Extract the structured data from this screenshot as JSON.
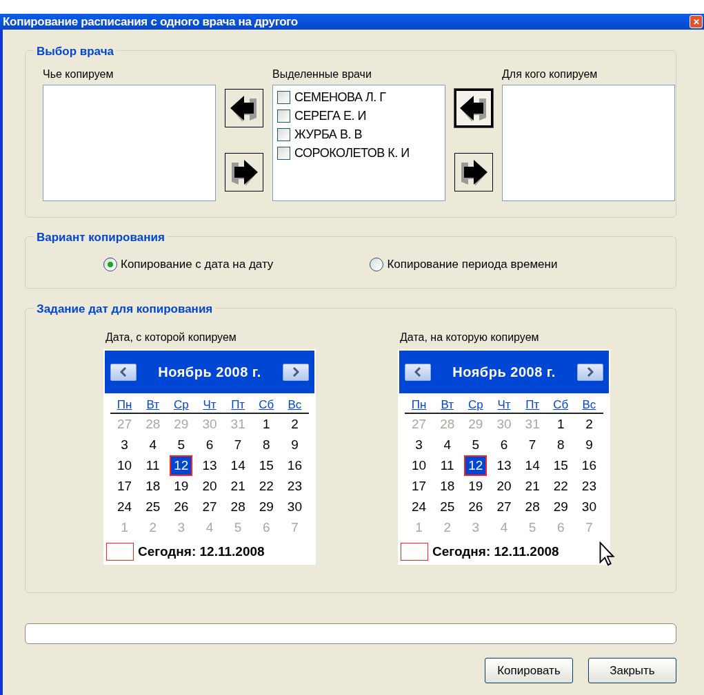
{
  "window": {
    "title": "Копирование расписания с одного врача на другого",
    "close": "✕"
  },
  "doctor_group": {
    "title": "Выбор врача",
    "source": {
      "label": "Чье копируем"
    },
    "selected": {
      "label": "Выделенные врачи",
      "items": [
        {
          "label": "СЕМЕНОВА Л. Г",
          "checked": false
        },
        {
          "label": "СЕРЕГА Е. И",
          "checked": false
        },
        {
          "label": "ЖУРБА В. В",
          "checked": false
        },
        {
          "label": "СОРОКОЛЕТОВ К. И",
          "checked": false
        }
      ]
    },
    "target": {
      "label": "Для кого копируем"
    },
    "left_arrows": [
      {
        "kind": "left",
        "focused": false
      },
      {
        "kind": "right",
        "focused": false
      }
    ],
    "right_arrows": [
      {
        "kind": "left",
        "focused": true
      },
      {
        "kind": "right",
        "focused": false
      }
    ]
  },
  "variant_group": {
    "title": "Вариант копирования",
    "options": [
      {
        "label": "Копирование с дата на дату",
        "selected": true
      },
      {
        "label": "Копирование периода времени",
        "selected": false
      }
    ]
  },
  "dates_group": {
    "title": "Задание дат для копирования",
    "calendars": [
      {
        "label": "Дата, с которой копируем",
        "month": "Ноябрь 2008 г.",
        "weekdays": [
          "Пн",
          "Вт",
          "Ср",
          "Чт",
          "Пт",
          "Сб",
          "Вс"
        ],
        "today": "Сегодня: 12.11.2008",
        "weeks": [
          [
            {
              "d": "27",
              "muted": true,
              "selected": false
            },
            {
              "d": "28",
              "muted": true,
              "selected": false
            },
            {
              "d": "29",
              "muted": true,
              "selected": false
            },
            {
              "d": "30",
              "muted": true,
              "selected": false
            },
            {
              "d": "31",
              "muted": true,
              "selected": false
            },
            {
              "d": "1",
              "muted": false,
              "selected": false
            },
            {
              "d": "2",
              "muted": false,
              "selected": false
            }
          ],
          [
            {
              "d": "3",
              "muted": false,
              "selected": false
            },
            {
              "d": "4",
              "muted": false,
              "selected": false
            },
            {
              "d": "5",
              "muted": false,
              "selected": false
            },
            {
              "d": "6",
              "muted": false,
              "selected": false
            },
            {
              "d": "7",
              "muted": false,
              "selected": false
            },
            {
              "d": "8",
              "muted": false,
              "selected": false
            },
            {
              "d": "9",
              "muted": false,
              "selected": false
            }
          ],
          [
            {
              "d": "10",
              "muted": false,
              "selected": false
            },
            {
              "d": "11",
              "muted": false,
              "selected": false
            },
            {
              "d": "12",
              "muted": false,
              "selected": true
            },
            {
              "d": "13",
              "muted": false,
              "selected": false
            },
            {
              "d": "14",
              "muted": false,
              "selected": false
            },
            {
              "d": "15",
              "muted": false,
              "selected": false
            },
            {
              "d": "16",
              "muted": false,
              "selected": false
            }
          ],
          [
            {
              "d": "17",
              "muted": false,
              "selected": false
            },
            {
              "d": "18",
              "muted": false,
              "selected": false
            },
            {
              "d": "19",
              "muted": false,
              "selected": false
            },
            {
              "d": "20",
              "muted": false,
              "selected": false
            },
            {
              "d": "21",
              "muted": false,
              "selected": false
            },
            {
              "d": "22",
              "muted": false,
              "selected": false
            },
            {
              "d": "23",
              "muted": false,
              "selected": false
            }
          ],
          [
            {
              "d": "24",
              "muted": false,
              "selected": false
            },
            {
              "d": "25",
              "muted": false,
              "selected": false
            },
            {
              "d": "26",
              "muted": false,
              "selected": false
            },
            {
              "d": "27",
              "muted": false,
              "selected": false
            },
            {
              "d": "28",
              "muted": false,
              "selected": false
            },
            {
              "d": "29",
              "muted": false,
              "selected": false
            },
            {
              "d": "30",
              "muted": false,
              "selected": false
            }
          ],
          [
            {
              "d": "1",
              "muted": true,
              "selected": false
            },
            {
              "d": "2",
              "muted": true,
              "selected": false
            },
            {
              "d": "3",
              "muted": true,
              "selected": false
            },
            {
              "d": "4",
              "muted": true,
              "selected": false
            },
            {
              "d": "5",
              "muted": true,
              "selected": false
            },
            {
              "d": "6",
              "muted": true,
              "selected": false
            },
            {
              "d": "7",
              "muted": true,
              "selected": false
            }
          ]
        ]
      },
      {
        "label": "Дата, на которую копируем",
        "month": "Ноябрь 2008 г.",
        "weekdays": [
          "Пн",
          "Вт",
          "Ср",
          "Чт",
          "Пт",
          "Сб",
          "Вс"
        ],
        "today": "Сегодня: 12.11.2008",
        "weeks": [
          [
            {
              "d": "27",
              "muted": true,
              "selected": false
            },
            {
              "d": "28",
              "muted": true,
              "selected": false
            },
            {
              "d": "29",
              "muted": true,
              "selected": false
            },
            {
              "d": "30",
              "muted": true,
              "selected": false
            },
            {
              "d": "31",
              "muted": true,
              "selected": false
            },
            {
              "d": "1",
              "muted": false,
              "selected": false
            },
            {
              "d": "2",
              "muted": false,
              "selected": false
            }
          ],
          [
            {
              "d": "3",
              "muted": false,
              "selected": false
            },
            {
              "d": "4",
              "muted": false,
              "selected": false
            },
            {
              "d": "5",
              "muted": false,
              "selected": false
            },
            {
              "d": "6",
              "muted": false,
              "selected": false
            },
            {
              "d": "7",
              "muted": false,
              "selected": false
            },
            {
              "d": "8",
              "muted": false,
              "selected": false
            },
            {
              "d": "9",
              "muted": false,
              "selected": false
            }
          ],
          [
            {
              "d": "10",
              "muted": false,
              "selected": false
            },
            {
              "d": "11",
              "muted": false,
              "selected": false
            },
            {
              "d": "12",
              "muted": false,
              "selected": true
            },
            {
              "d": "13",
              "muted": false,
              "selected": false
            },
            {
              "d": "14",
              "muted": false,
              "selected": false
            },
            {
              "d": "15",
              "muted": false,
              "selected": false
            },
            {
              "d": "16",
              "muted": false,
              "selected": false
            }
          ],
          [
            {
              "d": "17",
              "muted": false,
              "selected": false
            },
            {
              "d": "18",
              "muted": false,
              "selected": false
            },
            {
              "d": "19",
              "muted": false,
              "selected": false
            },
            {
              "d": "20",
              "muted": false,
              "selected": false
            },
            {
              "d": "21",
              "muted": false,
              "selected": false
            },
            {
              "d": "22",
              "muted": false,
              "selected": false
            },
            {
              "d": "23",
              "muted": false,
              "selected": false
            }
          ],
          [
            {
              "d": "24",
              "muted": false,
              "selected": false
            },
            {
              "d": "25",
              "muted": false,
              "selected": false
            },
            {
              "d": "26",
              "muted": false,
              "selected": false
            },
            {
              "d": "27",
              "muted": false,
              "selected": false
            },
            {
              "d": "28",
              "muted": false,
              "selected": false
            },
            {
              "d": "29",
              "muted": false,
              "selected": false
            },
            {
              "d": "30",
              "muted": false,
              "selected": false
            }
          ],
          [
            {
              "d": "1",
              "muted": true,
              "selected": false
            },
            {
              "d": "2",
              "muted": true,
              "selected": false
            },
            {
              "d": "3",
              "muted": true,
              "selected": false
            },
            {
              "d": "4",
              "muted": true,
              "selected": false
            },
            {
              "d": "5",
              "muted": true,
              "selected": false
            },
            {
              "d": "6",
              "muted": true,
              "selected": false
            },
            {
              "d": "7",
              "muted": true,
              "selected": false
            }
          ]
        ]
      }
    ]
  },
  "progress": {
    "level": 0
  },
  "buttons": [
    "Копировать",
    "Закрыть"
  ]
}
